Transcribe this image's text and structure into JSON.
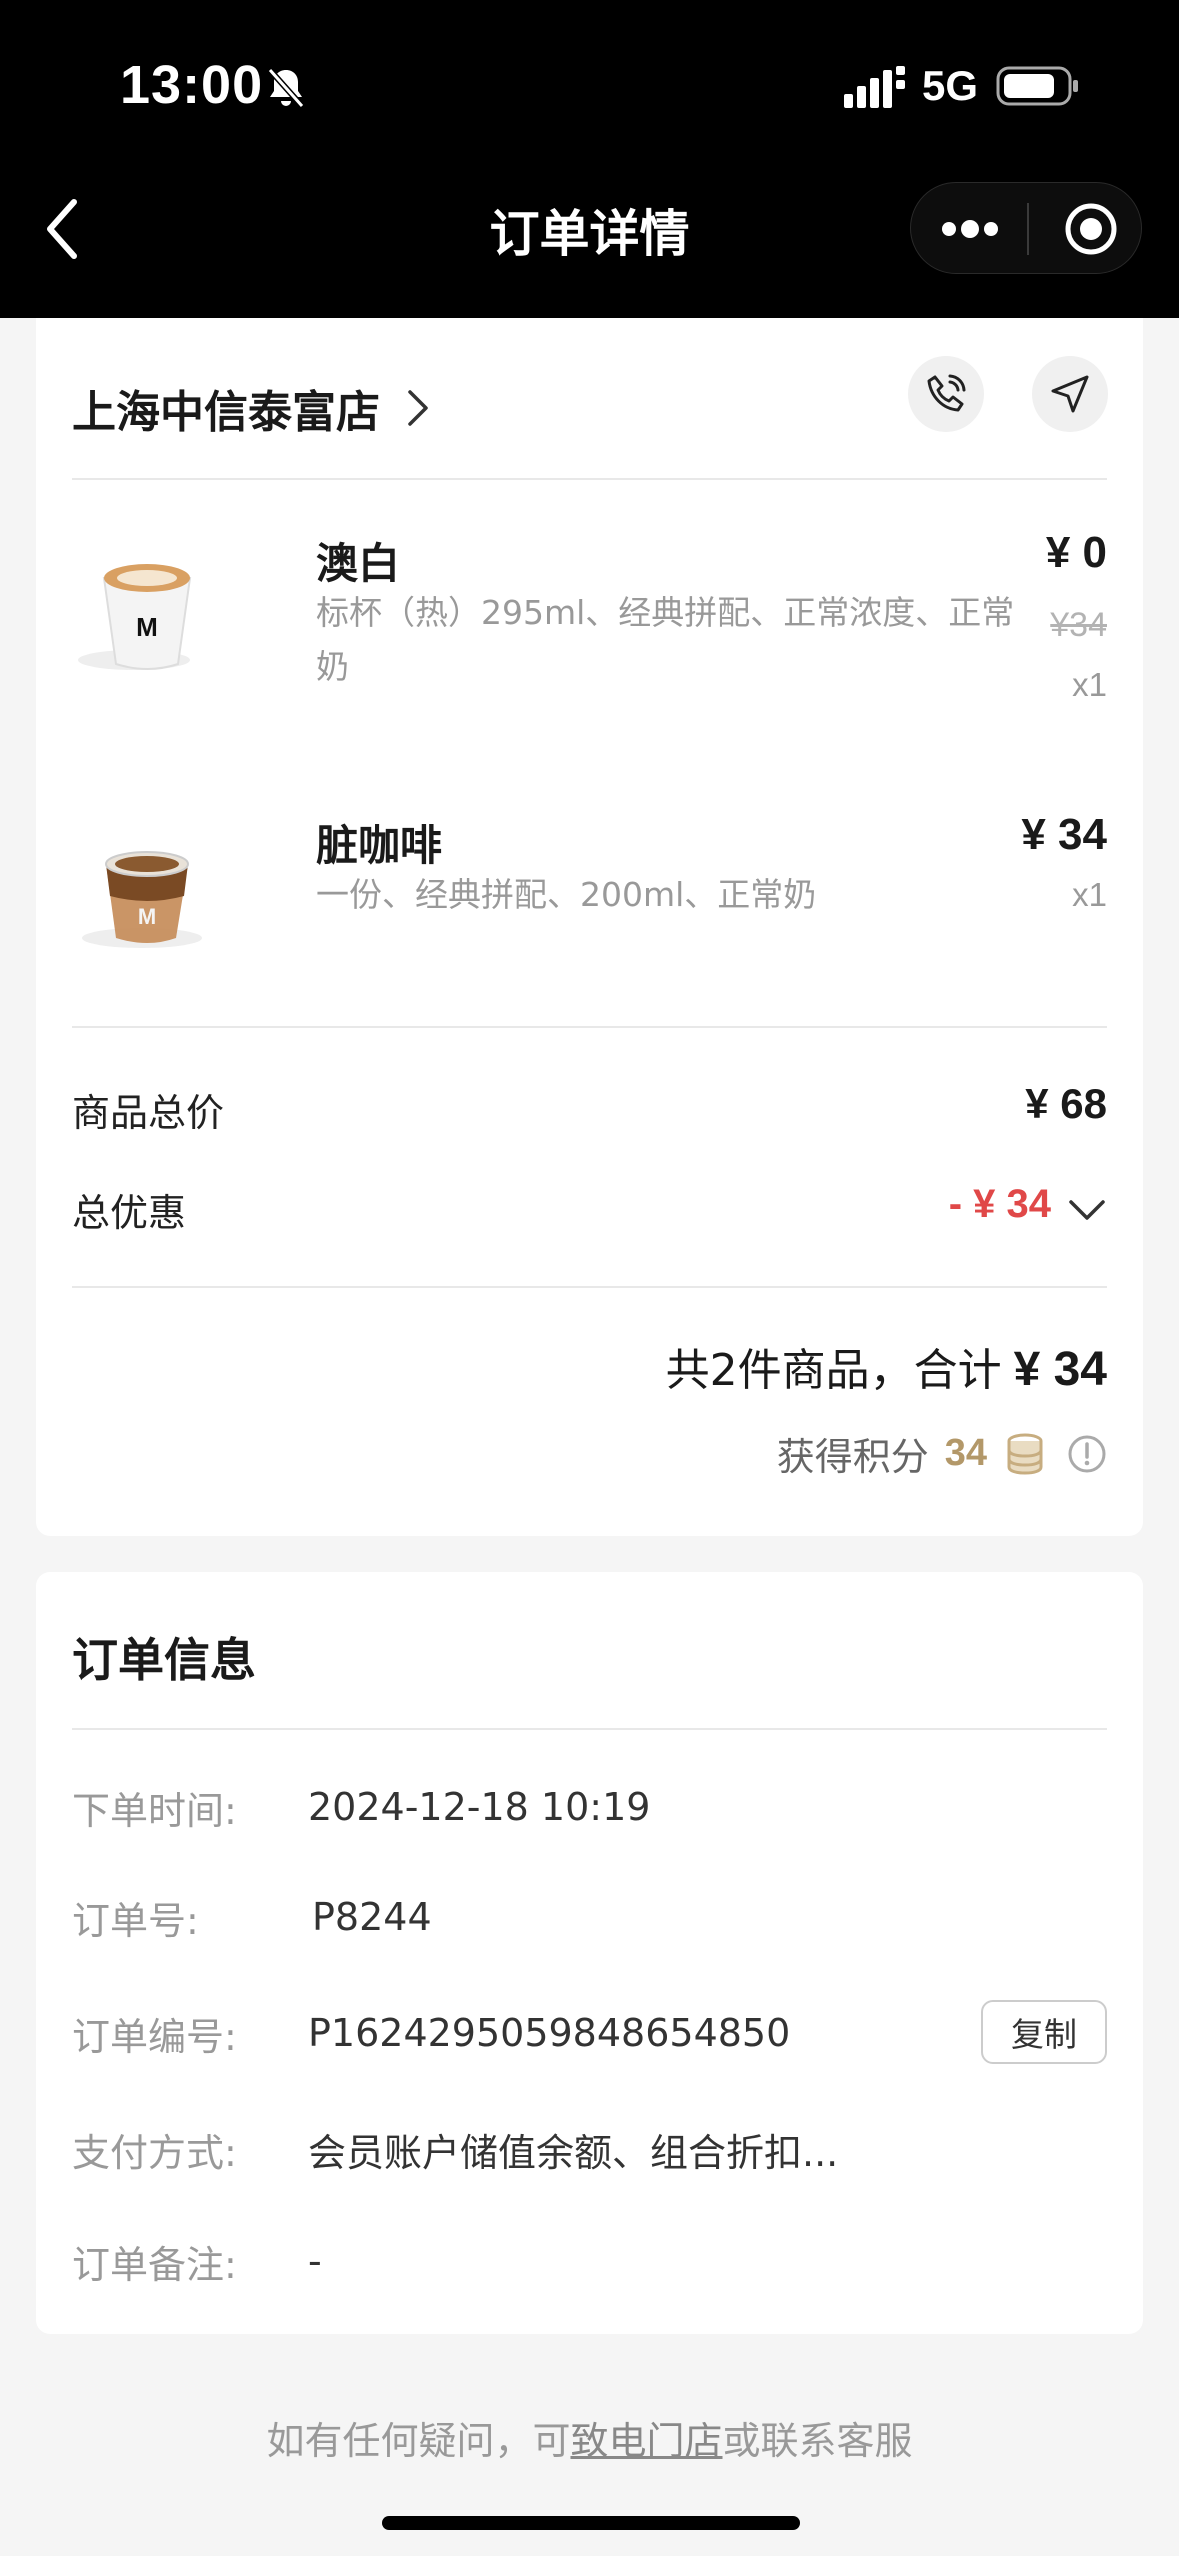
{
  "status_bar": {
    "time": "13:00",
    "network": "5G"
  },
  "nav": {
    "title": "订单详情"
  },
  "store": {
    "name": "上海中信泰富店"
  },
  "items": [
    {
      "name": "澳白",
      "desc": "标杯（热）295ml、经典拼配、正常浓度、正常奶",
      "price": "¥ 0",
      "original_price": "¥34",
      "qty": "x1"
    },
    {
      "name": "脏咖啡",
      "desc": "一份、经典拼配、200ml、正常奶",
      "price": "¥ 34",
      "qty": "x1"
    }
  ],
  "summary": {
    "goods_total_label": "商品总价",
    "goods_total_value": "¥ 68",
    "discount_label": "总优惠",
    "discount_value": "- ¥ 34",
    "total_prefix": "共2件商品，合计",
    "total_amount": "¥ 34",
    "points_label": "获得积分",
    "points_value": "34"
  },
  "order_info": {
    "title": "订单信息",
    "rows": [
      {
        "label": "下单时间:",
        "value": "2024-12-18 10:19"
      },
      {
        "label": "订单号:",
        "value": "P8244"
      },
      {
        "label": "订单编号:",
        "value": "P1624295059848654850"
      },
      {
        "label": "支付方式:",
        "value": "会员账户储值余额、组合折扣..."
      },
      {
        "label": "订单备注:",
        "value": "-"
      }
    ],
    "copy_label": "复制"
  },
  "footer": {
    "prefix": "如有任何疑问，可",
    "link": "致电门店",
    "suffix": "或联系客服"
  },
  "colors": {
    "discount": "#e04848",
    "points": "#b39869",
    "topbar": "#000000"
  }
}
